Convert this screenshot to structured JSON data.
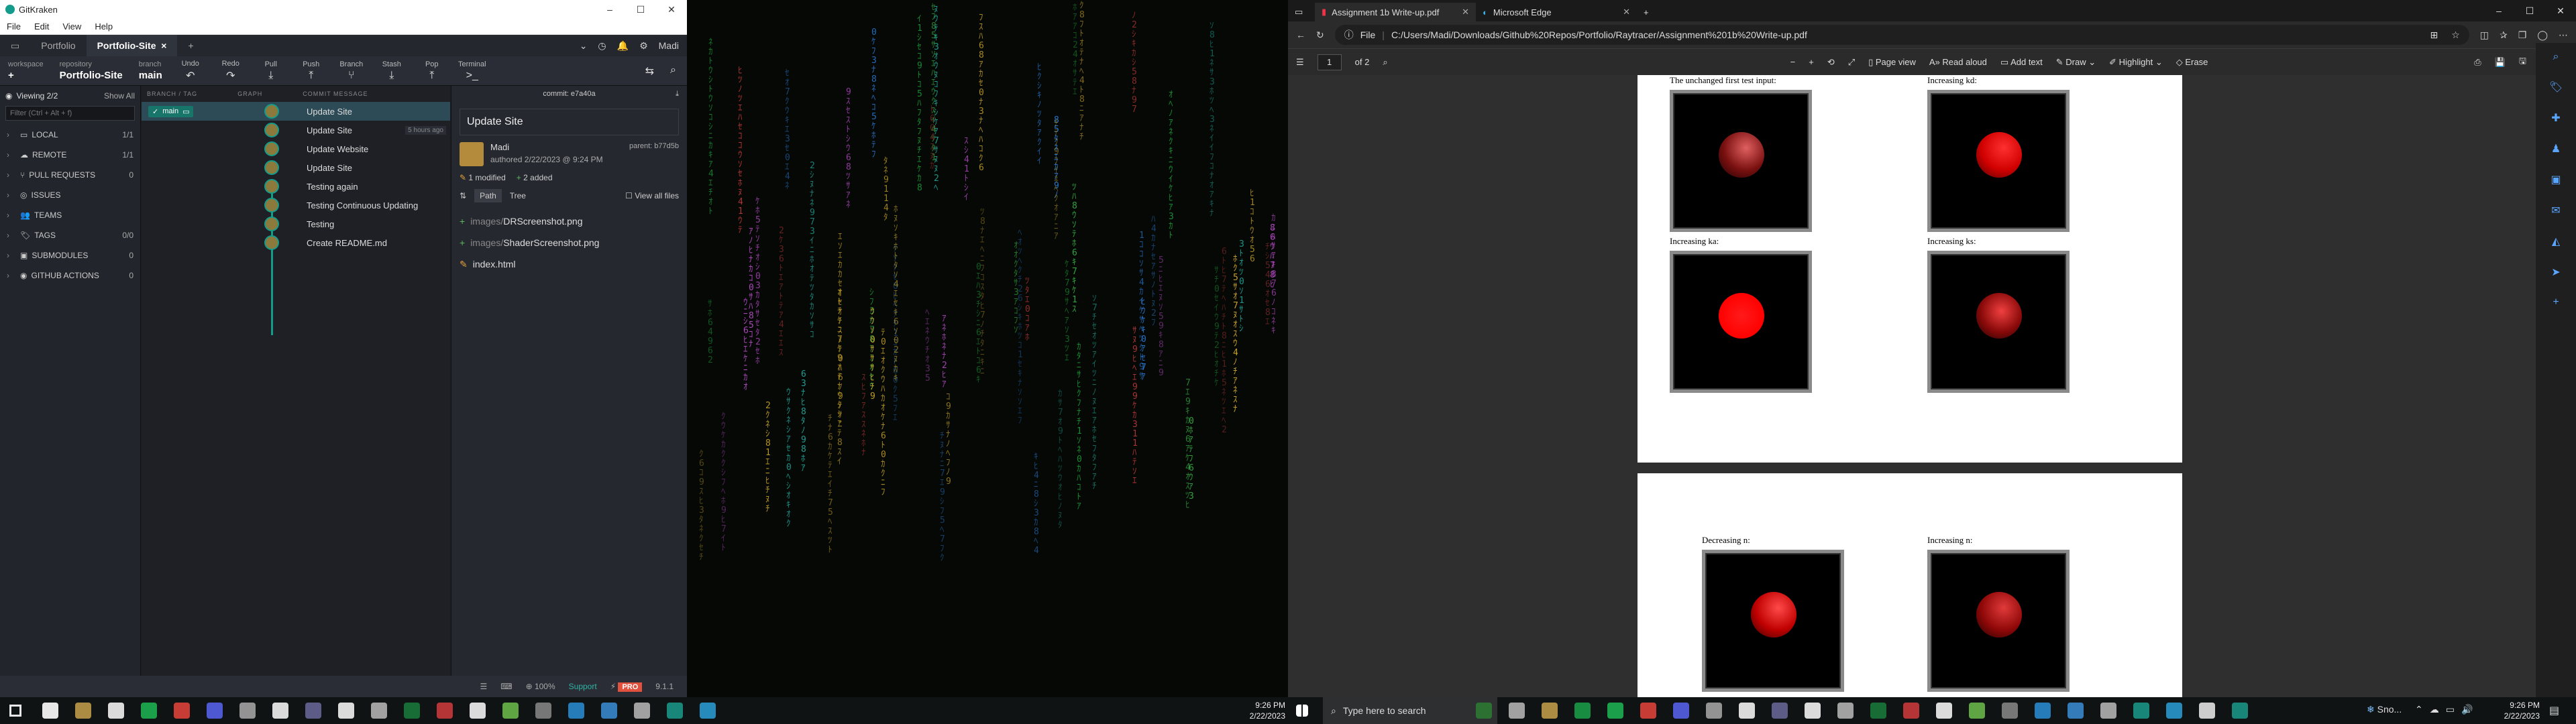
{
  "gitkraken": {
    "window_title": "GitKraken",
    "menu": [
      "File",
      "Edit",
      "View",
      "Help"
    ],
    "tabs": [
      "Portfolio",
      "Portfolio-Site"
    ],
    "profile": "Madi",
    "toolbar": {
      "workspace_label": "workspace",
      "repository_label": "repository",
      "repository": "Portfolio-Site",
      "branch_label": "branch",
      "branch": "main",
      "buttons": [
        "Undo",
        "Redo",
        "Pull",
        "Push",
        "Branch",
        "Stash",
        "Pop"
      ],
      "terminal": "Terminal"
    },
    "left": {
      "viewing": "Viewing 2/2",
      "show_all": "Show All",
      "filter_placeholder": "Filter (Ctrl + Alt + f)",
      "sections": [
        {
          "label": "LOCAL",
          "count": "1/1"
        },
        {
          "label": "REMOTE",
          "count": "1/1"
        },
        {
          "label": "PULL REQUESTS",
          "count": "0"
        },
        {
          "label": "ISSUES",
          "count": ""
        },
        {
          "label": "TEAMS",
          "count": ""
        },
        {
          "label": "TAGS",
          "count": "0/0"
        },
        {
          "label": "SUBMODULES",
          "count": "0"
        },
        {
          "label": "GITHUB ACTIONS",
          "count": "0"
        }
      ]
    },
    "graph": {
      "headers": [
        "BRANCH / TAG",
        "GRAPH",
        "COMMIT MESSAGE"
      ],
      "branch": "main",
      "time_badge": "5 hours ago",
      "commits": [
        "Update Site",
        "Update Site",
        "Update Website",
        "Update Site",
        "Testing again",
        "Testing Continuous Updating",
        "Testing",
        "Create README.md"
      ]
    },
    "detail": {
      "commit": "commit: e7a40a",
      "title": "Update Site",
      "author": "Madi",
      "authored": "authored 2/22/2023 @ 9:24 PM",
      "parent": "parent: b77d5b",
      "modified": "1 modified",
      "added": "2 added",
      "path": "Path",
      "tree": "Tree",
      "view_all": "View all files",
      "files": [
        {
          "dir": "images/",
          "name": "DRScreenshot.png",
          "type": "added"
        },
        {
          "dir": "images/",
          "name": "ShaderScreenshot.png",
          "type": "added"
        },
        {
          "dir": "",
          "name": "index.html",
          "type": "modified"
        }
      ]
    },
    "status": {
      "zoom": "100%",
      "support": "Support",
      "pro": "PRO",
      "version": "9.1.1"
    }
  },
  "edge": {
    "tabs": [
      "Assignment 1b Write-up.pdf",
      "Microsoft Edge"
    ],
    "url_prefix": "File",
    "url": "C:/Users/Madi/Downloads/Github%20Repos/Portfolio/Raytracer/Assignment%201b%20Write-up.pdf",
    "page": "1",
    "of": "of 2",
    "pdf_tools": [
      "Page view",
      "Read aloud",
      "Add text",
      "Draw",
      "Highlight",
      "Erase"
    ],
    "captions": [
      "The unchanged first test input:",
      "Increasing kd:",
      "Increasing ka:",
      "Increasing ks:",
      "Decreasing n:",
      "Increasing n:"
    ]
  },
  "taskbar": {
    "search_placeholder": "Type here to search",
    "clock_left": {
      "time": "9:26 PM",
      "date": "2/22/2023"
    },
    "clock_right": {
      "time": "9:26 PM",
      "date": "2/22/2023"
    },
    "weather": "Sno..."
  }
}
